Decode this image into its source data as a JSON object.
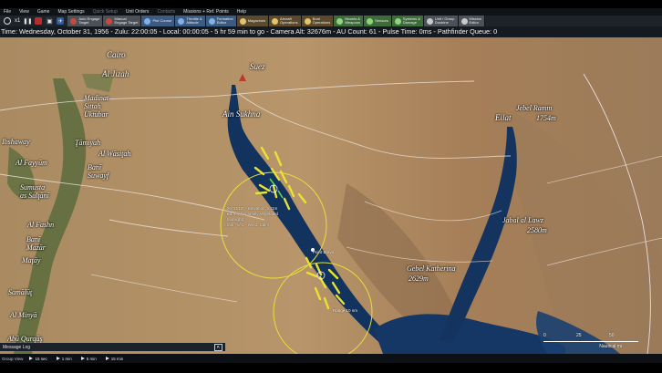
{
  "menu": {
    "items": [
      "File",
      "View",
      "Game",
      "Map Settings",
      "Quick Setup",
      "Unit Orders",
      "Contacts",
      "Missions + Ref. Points",
      "Help"
    ],
    "disabled": [
      "Quick Setup",
      "Contacts"
    ]
  },
  "sim_controls": {
    "speed": "x1"
  },
  "toolbar": {
    "buttons": [
      {
        "label": "Auto Engage\nTarget",
        "style": "grey",
        "icon": "target-icon",
        "color": "#c84a3c"
      },
      {
        "label": "Manual\nEngage Target",
        "style": "grey",
        "icon": "crosshair-icon",
        "color": "#c84a3c"
      },
      {
        "label": "Plot Course",
        "style": "blue",
        "icon": "course-icon",
        "color": "#7fb0e6"
      },
      {
        "label": "Throttle &\nAltitude",
        "style": "blue",
        "icon": "throttle-icon",
        "color": "#7fb0e6"
      },
      {
        "label": "Formation\nEditor",
        "style": "blue",
        "icon": "formation-icon",
        "color": "#7fb0e6"
      },
      {
        "label": "Magazines",
        "style": "brown",
        "icon": "magazine-icon",
        "color": "#e2c36e"
      },
      {
        "label": "Aircraft\nOperations",
        "style": "brown",
        "icon": "aircraft-icon",
        "color": "#e2c36e"
      },
      {
        "label": "Boat\nOperations",
        "style": "brown",
        "icon": "boat-icon",
        "color": "#e2c36e"
      },
      {
        "label": "Mounts &\nWeapons",
        "style": "green",
        "icon": "weapons-icon",
        "color": "#8fd37f"
      },
      {
        "label": "Sensors",
        "style": "green",
        "icon": "sensor-icon",
        "color": "#8fd37f"
      },
      {
        "label": "Systems &\nDamage",
        "style": "green",
        "icon": "damage-icon",
        "color": "#8fd37f"
      },
      {
        "label": "Unit / Group\nDoctrine",
        "style": "grey",
        "icon": "doctrine-icon",
        "color": "#c9c9c9"
      },
      {
        "label": "Mission\nEditor",
        "style": "grey",
        "icon": "mission-icon",
        "color": "#c9c9c9"
      }
    ]
  },
  "status_bar": "Time: Wednesday, October 31, 1956 - Zulu: 22:00:05 - Local: 00:00:05 - 5 hr 59 min to go -  Camera Alt: 32676m - AU Count: 61 - Pulse Time: 0ms - Pathfinder Queue: 0",
  "map": {
    "places": {
      "cairo": "Cairo",
      "al_jizah": "Al Jizah",
      "madinat": "Madinat\nSittah\nUktubar",
      "ibshaway": "Ibshaway",
      "tamiyah": "Ţāmiyah",
      "al_fayyum": "Al Fayyūm",
      "al_wasitah": "Al Wāsiţah",
      "bani_suwayf": "Banī\nSuwayf",
      "sumusta": "Sumusta\nas Sulţānī",
      "al_fashn": "Al Fashn",
      "bani_mazar": "Banī\nMazār",
      "matay": "Maţāy",
      "samalut": "Samālūţ",
      "al_minya": "Al Minyā",
      "abu_qurqas": "Abū Qurqāş",
      "suez": "Suez",
      "ain_sukhna": "Ain Sukhna",
      "eilat": "Eilat"
    },
    "peaks": {
      "ramm_name": "Jebel Ramm",
      "ramm_elev": "1754m",
      "lawz_name": "Jabal al Lawz",
      "lawz_elev": "2580m",
      "katherina_name": "Gebel Katherina",
      "katherina_elev": "2629m"
    },
    "unit_info": [
      "...29°31'12\" - Elevation: 241m",
      "...Barren / Sparsely Vegetated",
      "...(sunlight)",
      "...rain - 5°C - Wind: Calm"
    ],
    "small_labels": {
      "point": "Point Bravo",
      "range": "Range 10 nm"
    },
    "scale": {
      "ticks": [
        "0",
        "25",
        "50"
      ],
      "unit": "Nautical mi"
    }
  },
  "message_log": {
    "title": "Message Log",
    "expand_icon": "expand-icon"
  },
  "time_bar": {
    "label": "Group View",
    "buttons": [
      "15 sec",
      "1 min",
      "5 min",
      "15 min"
    ]
  }
}
